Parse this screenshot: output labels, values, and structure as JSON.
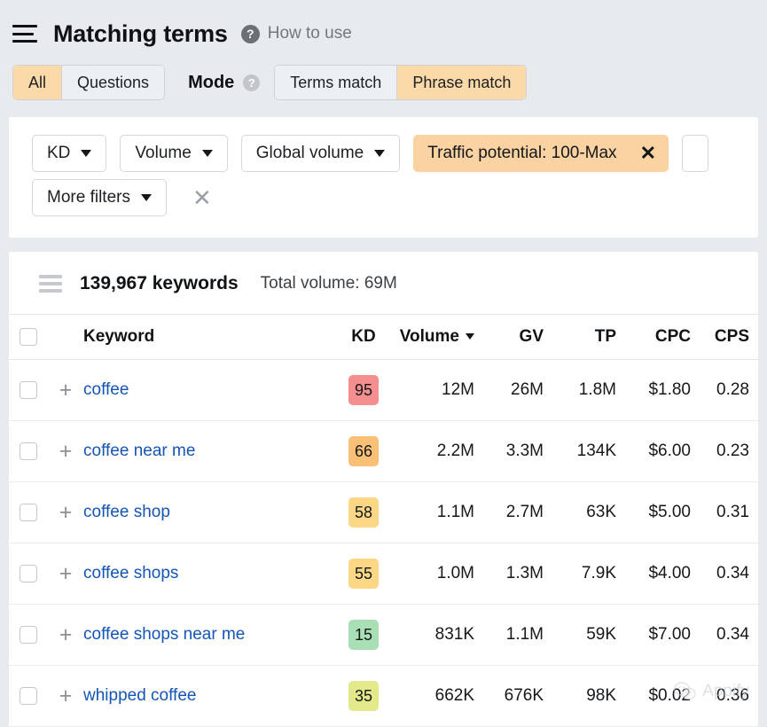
{
  "header": {
    "menu_icon": "hamburger-icon",
    "title": "Matching terms",
    "help_icon": "question-mark-icon",
    "how_to_use": "How to use"
  },
  "toggles": {
    "scope": {
      "options": [
        "All",
        "Questions"
      ],
      "selected": "All"
    },
    "mode_label": "Mode",
    "mode_help_icon": "question-mark-icon",
    "mode": {
      "options": [
        "Terms match",
        "Phrase match"
      ],
      "selected": "Phrase match"
    }
  },
  "filters": {
    "buttons": [
      "KD",
      "Volume",
      "Global volume"
    ],
    "active_chip": {
      "label": "Traffic potential: 100-Max",
      "remove_icon": "close-icon"
    },
    "more_filters": "More filters",
    "clear_icon": "clear-filters-icon"
  },
  "results": {
    "list_icon": "list-icon",
    "keyword_count": "139,967 keywords",
    "total_volume": "Total volume: 69M"
  },
  "table": {
    "columns": {
      "keyword": "Keyword",
      "kd": "KD",
      "volume": "Volume",
      "gv": "GV",
      "tp": "TP",
      "cpc": "CPC",
      "cps": "CPS"
    },
    "sorted_by": "Volume",
    "sort_direction": "desc",
    "rows": [
      {
        "keyword": "coffee",
        "kd": "95",
        "kd_color": "#f58e8e",
        "volume": "12M",
        "gv": "26M",
        "tp": "1.8M",
        "cpc": "$1.80",
        "cps": "0.28"
      },
      {
        "keyword": "coffee near me",
        "kd": "66",
        "kd_color": "#fbc078",
        "volume": "2.2M",
        "gv": "3.3M",
        "tp": "134K",
        "cpc": "$6.00",
        "cps": "0.23"
      },
      {
        "keyword": "coffee shop",
        "kd": "58",
        "kd_color": "#fcd786",
        "volume": "1.1M",
        "gv": "2.7M",
        "tp": "63K",
        "cpc": "$5.00",
        "cps": "0.31"
      },
      {
        "keyword": "coffee shops",
        "kd": "55",
        "kd_color": "#fcd786",
        "volume": "1.0M",
        "gv": "1.3M",
        "tp": "7.9K",
        "cpc": "$4.00",
        "cps": "0.34"
      },
      {
        "keyword": "coffee shops near me",
        "kd": "15",
        "kd_color": "#a8dfb4",
        "volume": "831K",
        "gv": "1.1M",
        "tp": "59K",
        "cpc": "$7.00",
        "cps": "0.34"
      },
      {
        "keyword": "whipped coffee",
        "kd": "35",
        "kd_color": "#e3e88a",
        "volume": "662K",
        "gv": "676K",
        "tp": "98K",
        "cpc": "$0.02",
        "cps": "0.36"
      }
    ]
  },
  "watermark": {
    "logo_icon": "wechat-icon",
    "text": "Appify"
  },
  "colors": {
    "page_background": "#e8ebee",
    "accent": "#fbd3a2",
    "link": "#1455b5"
  }
}
